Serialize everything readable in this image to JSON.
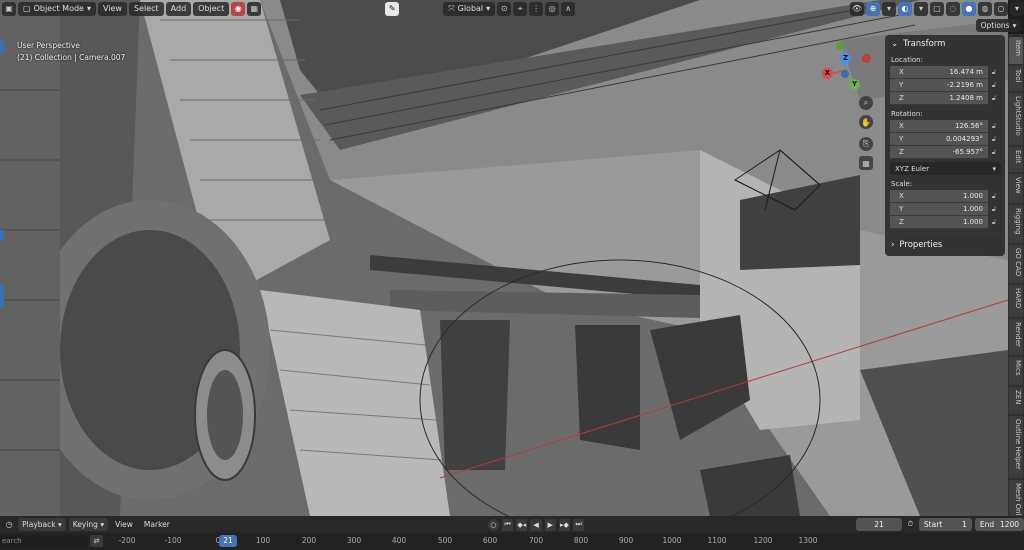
{
  "header": {
    "mode": "Object Mode",
    "menu": [
      "View",
      "Select",
      "Add",
      "Object"
    ],
    "orientation": "Global",
    "options_label": "Options"
  },
  "overlay": {
    "perspective": "User Perspective",
    "collection": "(21) Collection | Camera.007"
  },
  "gizmo": {
    "x": "X",
    "y": "Y",
    "z": "Z"
  },
  "npanel": {
    "title": "Transform",
    "location_label": "Location:",
    "location": [
      {
        "axis": "X",
        "value": "16.474 m"
      },
      {
        "axis": "Y",
        "value": "-2.2196 m"
      },
      {
        "axis": "Z",
        "value": "1.2408 m"
      }
    ],
    "rotation_label": "Rotation:",
    "rotation": [
      {
        "axis": "X",
        "value": "126.56°"
      },
      {
        "axis": "Y",
        "value": "0.004293°"
      },
      {
        "axis": "Z",
        "value": "-65.957°"
      }
    ],
    "rotation_mode": "XYZ Euler",
    "scale_label": "Scale:",
    "scale": [
      {
        "axis": "X",
        "value": "1.000"
      },
      {
        "axis": "Y",
        "value": "1.000"
      },
      {
        "axis": "Z",
        "value": "1.000"
      }
    ],
    "properties": "Properties"
  },
  "side_tabs": [
    "Item",
    "Tool",
    "LightStudio",
    "Edit",
    "View",
    "Rigging",
    "GO CAD",
    "HARD",
    "Render",
    "Mics",
    "ZEN",
    "Outline Helper",
    "Mesh Onl"
  ],
  "timeline": {
    "playback": "Playback",
    "keying": "Keying",
    "view": "View",
    "marker": "Marker",
    "current_frame": "21",
    "start_label": "Start",
    "start": "1",
    "end_label": "End",
    "end": "1200",
    "search_placeholder": "earch",
    "ticks": [
      "-200",
      "-100",
      "0",
      "100",
      "200",
      "300",
      "400",
      "500",
      "600",
      "700",
      "800",
      "900",
      "1000",
      "1100",
      "1200",
      "1300"
    ]
  }
}
